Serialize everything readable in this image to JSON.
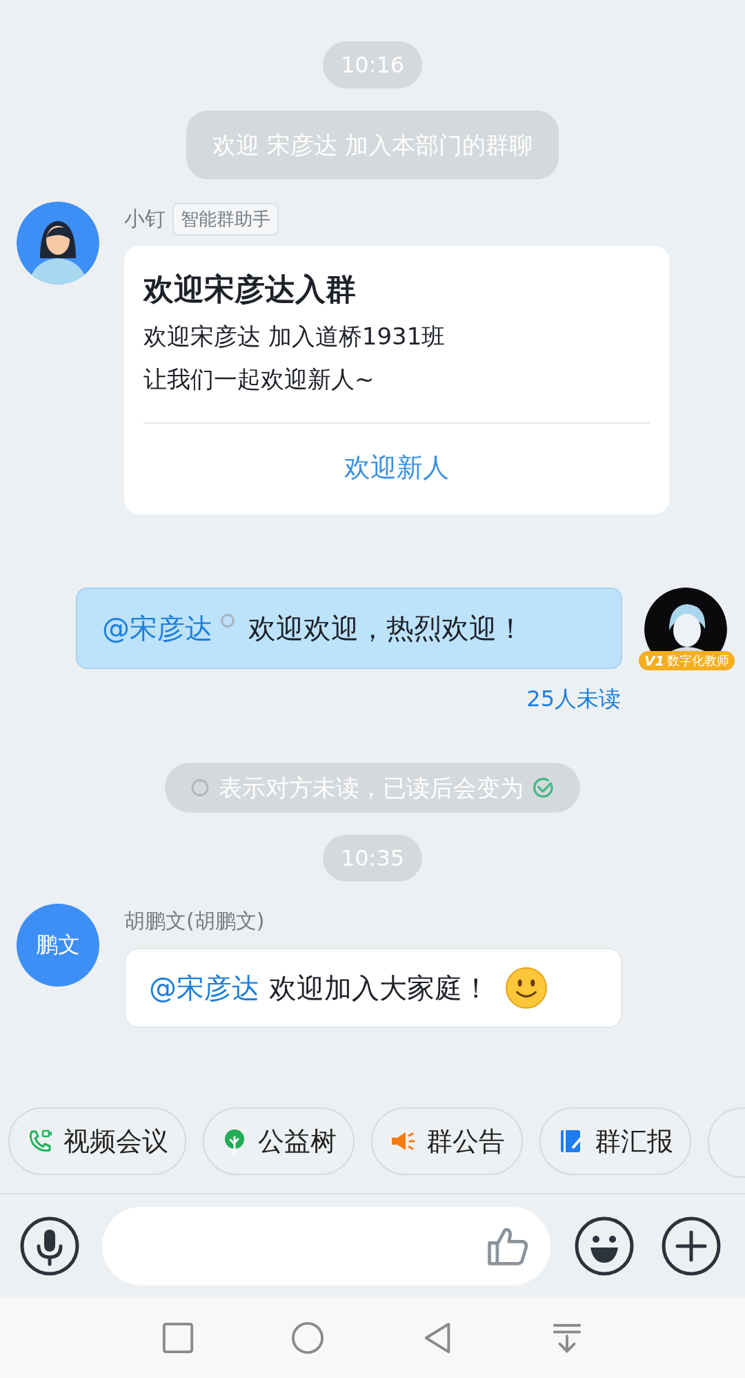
{
  "messages": [
    {
      "kind": "time",
      "text": "10:16"
    },
    {
      "kind": "system",
      "text": "欢迎 宋彦达 加入本部门的群聊"
    },
    {
      "kind": "card",
      "sender": "小钉",
      "sender_tag": "智能群助手",
      "card": {
        "title": "欢迎宋彦达入群",
        "lines": [
          "欢迎宋彦达 加入道桥1931班",
          "让我们一起欢迎新人~"
        ],
        "action": "欢迎新人"
      }
    },
    {
      "kind": "outgoing",
      "mention": "@宋彦达",
      "mention_read": false,
      "text": "欢迎欢迎，热烈欢迎！",
      "avatar_badge": {
        "rank": "V1",
        "title": "数字化教师"
      },
      "receipt": "25人未读"
    },
    {
      "kind": "hint",
      "text": "表示对方未读，已读后会变为"
    },
    {
      "kind": "time",
      "text": "10:35"
    },
    {
      "kind": "incoming",
      "avatar_text": "鹏文",
      "sender": "胡鹏文(胡鹏文)",
      "mention": "@宋彦达",
      "text": "欢迎加入大家庭！",
      "emoji": true
    }
  ],
  "quick_actions": [
    {
      "kind": "video",
      "label": "视频会议"
    },
    {
      "kind": "tree",
      "label": "公益树"
    },
    {
      "kind": "megaphone",
      "label": "群公告"
    },
    {
      "kind": "report",
      "label": "群汇报"
    },
    {
      "kind": "partial"
    }
  ]
}
